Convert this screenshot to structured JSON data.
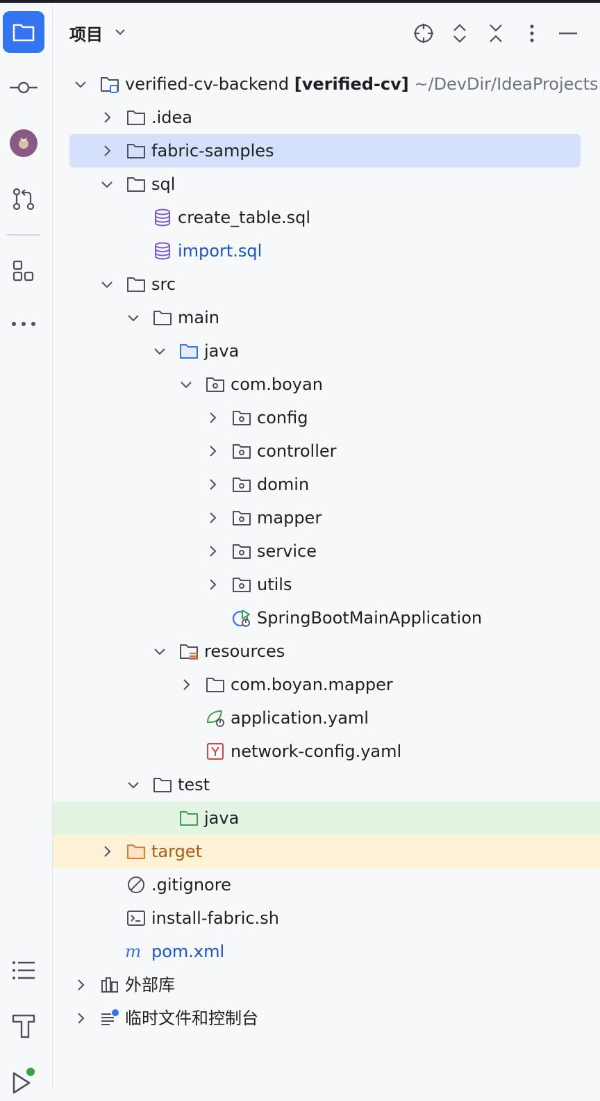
{
  "panel": {
    "title": "项目",
    "icons": [
      "locate-icon",
      "expand-all-icon",
      "collapse-all-icon",
      "more-options-icon",
      "hide-icon"
    ]
  },
  "toolstrip": {
    "items": [
      "project-icon",
      "commit-icon",
      "avatar",
      "pull-requests-icon",
      "structure-icon",
      "more-tools-icon",
      "todo-icon",
      "build-icon",
      "run-icon"
    ]
  },
  "tree": {
    "root": {
      "name": "verified-cv-backend",
      "module": "[verified-cv]",
      "path": "~/DevDir/IdeaProjects"
    },
    "idea": ".idea",
    "fabric_samples": "fabric-samples",
    "sql": "sql",
    "create_table": "create_table.sql",
    "import_sql": "import.sql",
    "src": "src",
    "main": "main",
    "java": "java",
    "com_boyan": "com.boyan",
    "config": "config",
    "controller": "controller",
    "domin": "domin",
    "mapper": "mapper",
    "service": "service",
    "utils": "utils",
    "app_class": "SpringBootMainApplication",
    "resources": "resources",
    "com_boyan_mapper": "com.boyan.mapper",
    "application_yaml": "application.yaml",
    "network_config": "network-config.yaml",
    "test": "test",
    "test_java": "java",
    "target": "target",
    "gitignore": ".gitignore",
    "install_fabric": "install-fabric.sh",
    "pom": "pom.xml",
    "external_libs": "外部库",
    "scratches": "临时文件和控制台"
  }
}
